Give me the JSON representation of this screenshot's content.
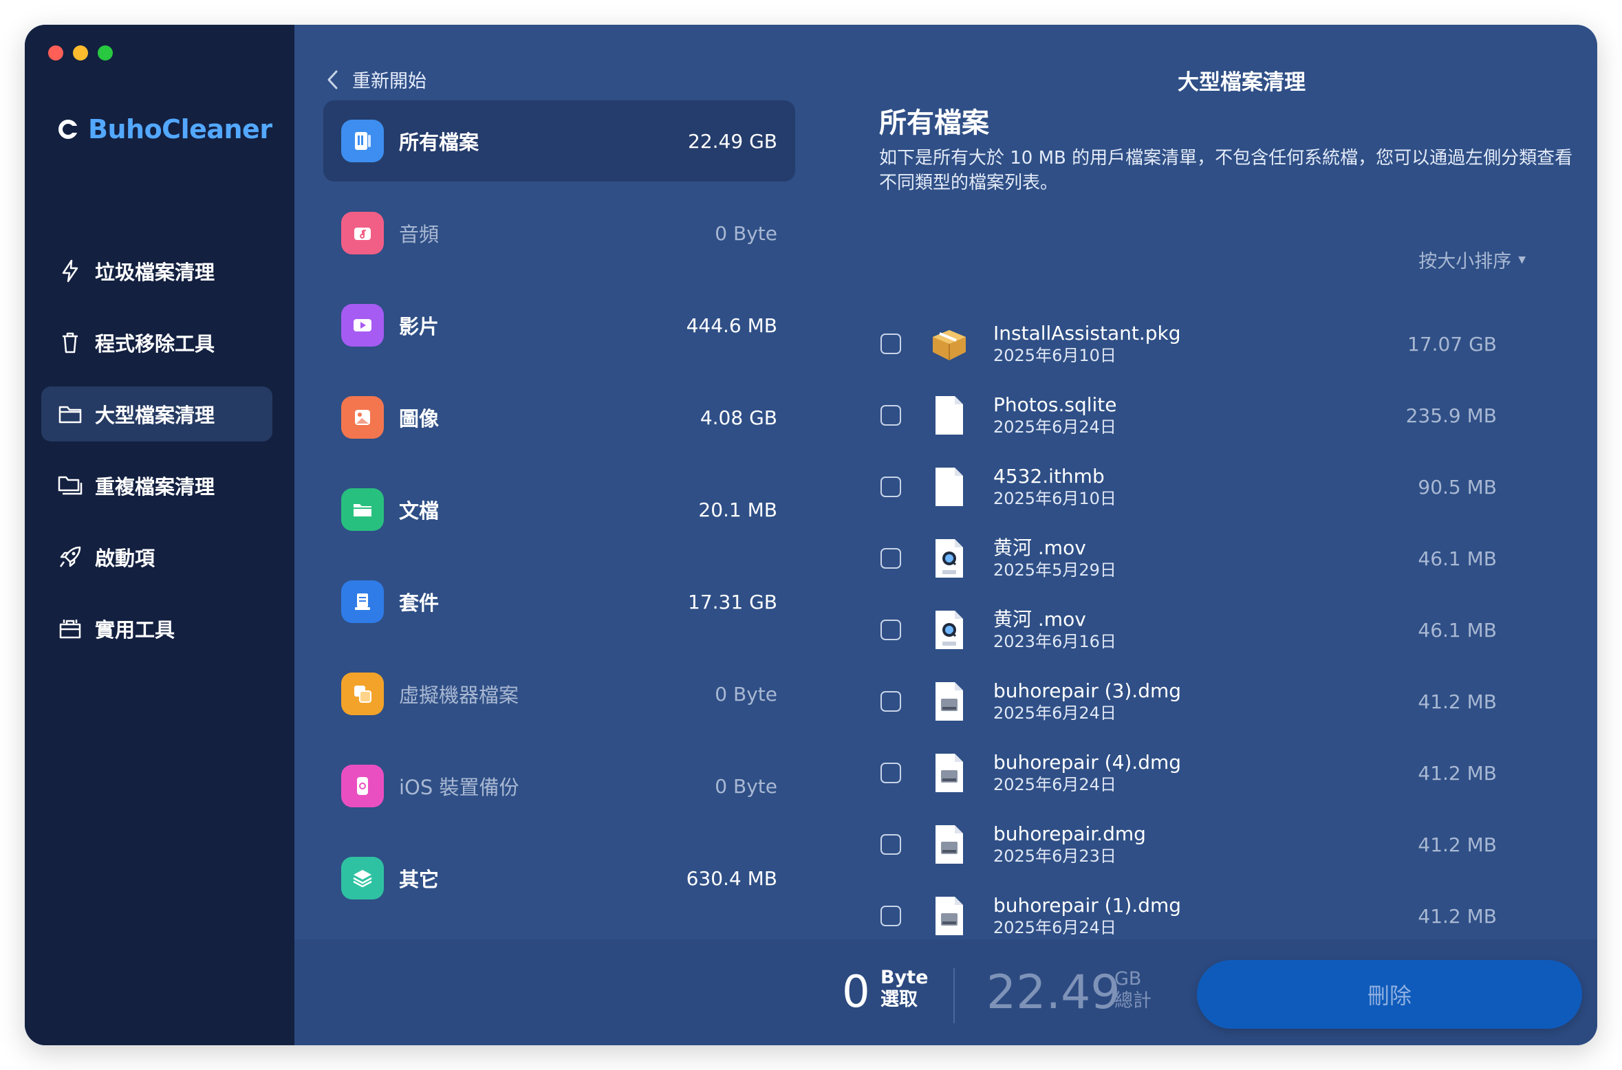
{
  "app": {
    "name": "BuhoCleaner",
    "traffic_colors": [
      "#ff5f57",
      "#febc2e",
      "#28c840"
    ]
  },
  "sidebar": {
    "items": [
      {
        "label": "垃圾檔案清理",
        "icon": "bolt-icon",
        "active": false
      },
      {
        "label": "程式移除工具",
        "icon": "trash-icon",
        "active": false
      },
      {
        "label": "大型檔案清理",
        "icon": "folder-icon",
        "active": true
      },
      {
        "label": "重複檔案清理",
        "icon": "duplicate-folder-icon",
        "active": false
      },
      {
        "label": "啟動項",
        "icon": "rocket-icon",
        "active": false
      },
      {
        "label": "實用工具",
        "icon": "toolbox-icon",
        "active": false
      }
    ]
  },
  "header": {
    "back_label": "重新開始",
    "title": "大型檔案清理"
  },
  "categories": [
    {
      "label": "所有檔案",
      "size": "22.49 GB",
      "icon": "all-files-icon",
      "color": "#3d8ef0",
      "active": true,
      "dim": false
    },
    {
      "label": "音頻",
      "size": "0 Byte",
      "icon": "audio-icon",
      "color": "#f25f86",
      "active": false,
      "dim": true
    },
    {
      "label": "影片",
      "size": "444.6 MB",
      "icon": "video-icon",
      "color": "#a65bf2",
      "active": false,
      "dim": false
    },
    {
      "label": "圖像",
      "size": "4.08 GB",
      "icon": "image-icon",
      "color": "#f3764f",
      "active": false,
      "dim": false
    },
    {
      "label": "文檔",
      "size": "20.1 MB",
      "icon": "documents-icon",
      "color": "#28c07e",
      "active": false,
      "dim": false
    },
    {
      "label": "套件",
      "size": "17.31 GB",
      "icon": "package-icon",
      "color": "#2f7ce8",
      "active": false,
      "dim": false
    },
    {
      "label": "虛擬機器檔案",
      "size": "0 Byte",
      "icon": "virtual-machine-icon",
      "color": "#f3a32a",
      "active": false,
      "dim": true
    },
    {
      "label": "iOS 裝置備份",
      "size": "0 Byte",
      "icon": "ios-backup-icon",
      "color": "#ea4fc1",
      "active": false,
      "dim": true
    },
    {
      "label": "其它",
      "size": "630.4 MB",
      "icon": "layers-icon",
      "color": "#2fc2a2",
      "active": false,
      "dim": false
    }
  ],
  "panel": {
    "title": "所有檔案",
    "description": "如下是所有大於 10 MB 的用戶檔案清單，不包含任何系統檔，您可以通過左側分類查看不同類型的檔案列表。",
    "sort_label": "按大小排序"
  },
  "files": [
    {
      "name": "InstallAssistant.pkg",
      "date": "2025年6月10日",
      "size": "17.07 GB",
      "icon": "package-box-icon",
      "checked": false
    },
    {
      "name": "Photos.sqlite",
      "date": "2025年6月24日",
      "size": "235.9 MB",
      "icon": "blank-document-icon",
      "checked": false
    },
    {
      "name": "4532.ithmb",
      "date": "2025年6月10日",
      "size": "90.5 MB",
      "icon": "blank-document-icon",
      "checked": false
    },
    {
      "name": "黄河 .mov",
      "date": "2025年5月29日",
      "size": "46.1 MB",
      "icon": "mov-file-icon",
      "checked": false
    },
    {
      "name": "黄河 .mov",
      "date": "2023年6月16日",
      "size": "46.1 MB",
      "icon": "mov-file-icon",
      "checked": false
    },
    {
      "name": "buhorepair (3).dmg",
      "date": "2025年6月24日",
      "size": "41.2 MB",
      "icon": "dmg-file-icon",
      "checked": false
    },
    {
      "name": "buhorepair (4).dmg",
      "date": "2025年6月24日",
      "size": "41.2 MB",
      "icon": "dmg-file-icon",
      "checked": false
    },
    {
      "name": "buhorepair.dmg",
      "date": "2025年6月23日",
      "size": "41.2 MB",
      "icon": "dmg-file-icon",
      "checked": false
    },
    {
      "name": "buhorepair (1).dmg",
      "date": "2025年6月24日",
      "size": "41.2 MB",
      "icon": "dmg-file-icon",
      "checked": false
    }
  ],
  "footer": {
    "selected_value": "0",
    "selected_unit": "Byte",
    "selected_label": "選取",
    "total_value": "22.49",
    "total_unit": "GB",
    "total_label": "總計",
    "delete_label": "刪除"
  }
}
